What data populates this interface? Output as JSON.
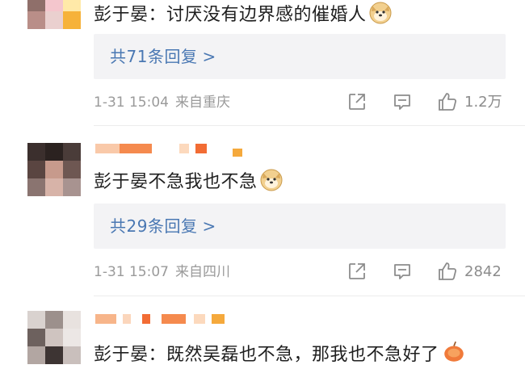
{
  "comments": [
    {
      "text": "彭于晏：讨厌没有边界感的催婚人",
      "replies_label": "共71条回复",
      "time": "1-31 15:04",
      "location": "来自重庆",
      "likes": "1.2万"
    },
    {
      "text": "彭于晏不急我也不急",
      "replies_label": "共29条回复",
      "time": "1-31 15:07",
      "location": "来自四川",
      "likes": "2842"
    },
    {
      "text": "彭于晏：既然吴磊也不急，那我也不急好了"
    }
  ],
  "icons": {
    "share": "share-icon",
    "comment": "comment-icon",
    "like": "thumbs-up-icon",
    "emoji_dog": "doge-emoji-icon"
  },
  "colors": {
    "link": "#4a78b3",
    "meta": "#9a9a9a",
    "reply_bg": "#f3f3f5"
  }
}
